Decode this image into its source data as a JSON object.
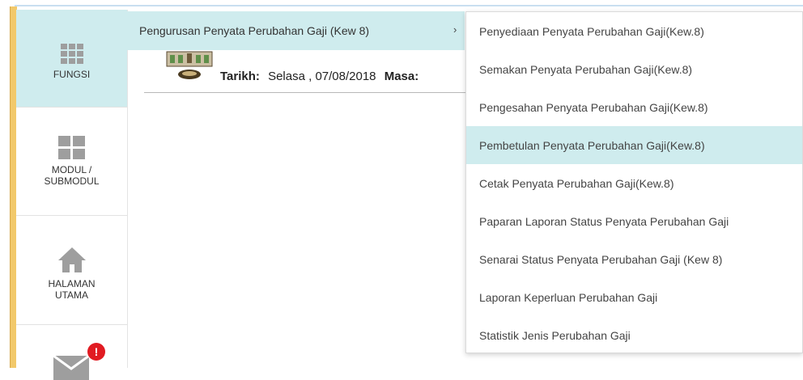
{
  "sidebar": {
    "items": [
      {
        "label": "FUNGSI",
        "icon": "apps-grid-icon",
        "active": true
      },
      {
        "label": "MODUL / SUBMODUL",
        "label_line1": "MODUL /",
        "label_line2": "SUBMODUL",
        "icon": "module-grid-icon"
      },
      {
        "label": "HALAMAN UTAMA",
        "label_line1": "HALAMAN",
        "label_line2": "UTAMA",
        "icon": "home-icon"
      },
      {
        "label": "",
        "icon": "mail-icon",
        "badge": "!"
      }
    ]
  },
  "breadcrumb": {
    "label": "Pengurusan Penyata Perubahan Gaji (Kew 8)",
    "chevron": "›"
  },
  "header": {
    "tarikh_label": "Tarikh:",
    "tarikh_value": "Selasa , 07/08/2018",
    "masa_label": "Masa:"
  },
  "dropdown": {
    "items": [
      "Penyediaan Penyata Perubahan Gaji(Kew.8)",
      "Semakan Penyata Perubahan Gaji(Kew.8)",
      "Pengesahan Penyata Perubahan Gaji(Kew.8)",
      "Pembetulan Penyata Perubahan Gaji(Kew.8)",
      "Cetak Penyata Perubahan Gaji(Kew.8)",
      "Paparan Laporan Status Penyata Perubahan Gaji",
      "Senarai Status Penyata Perubahan Gaji (Kew 8)",
      "Laporan Keperluan Perubahan Gaji",
      "Statistik Jenis Perubahan Gaji"
    ],
    "highlighted_index": 3
  },
  "colors": {
    "accent_bg": "#cfecee",
    "badge": "#e11b22",
    "gold_bar": "#f2c96b"
  }
}
